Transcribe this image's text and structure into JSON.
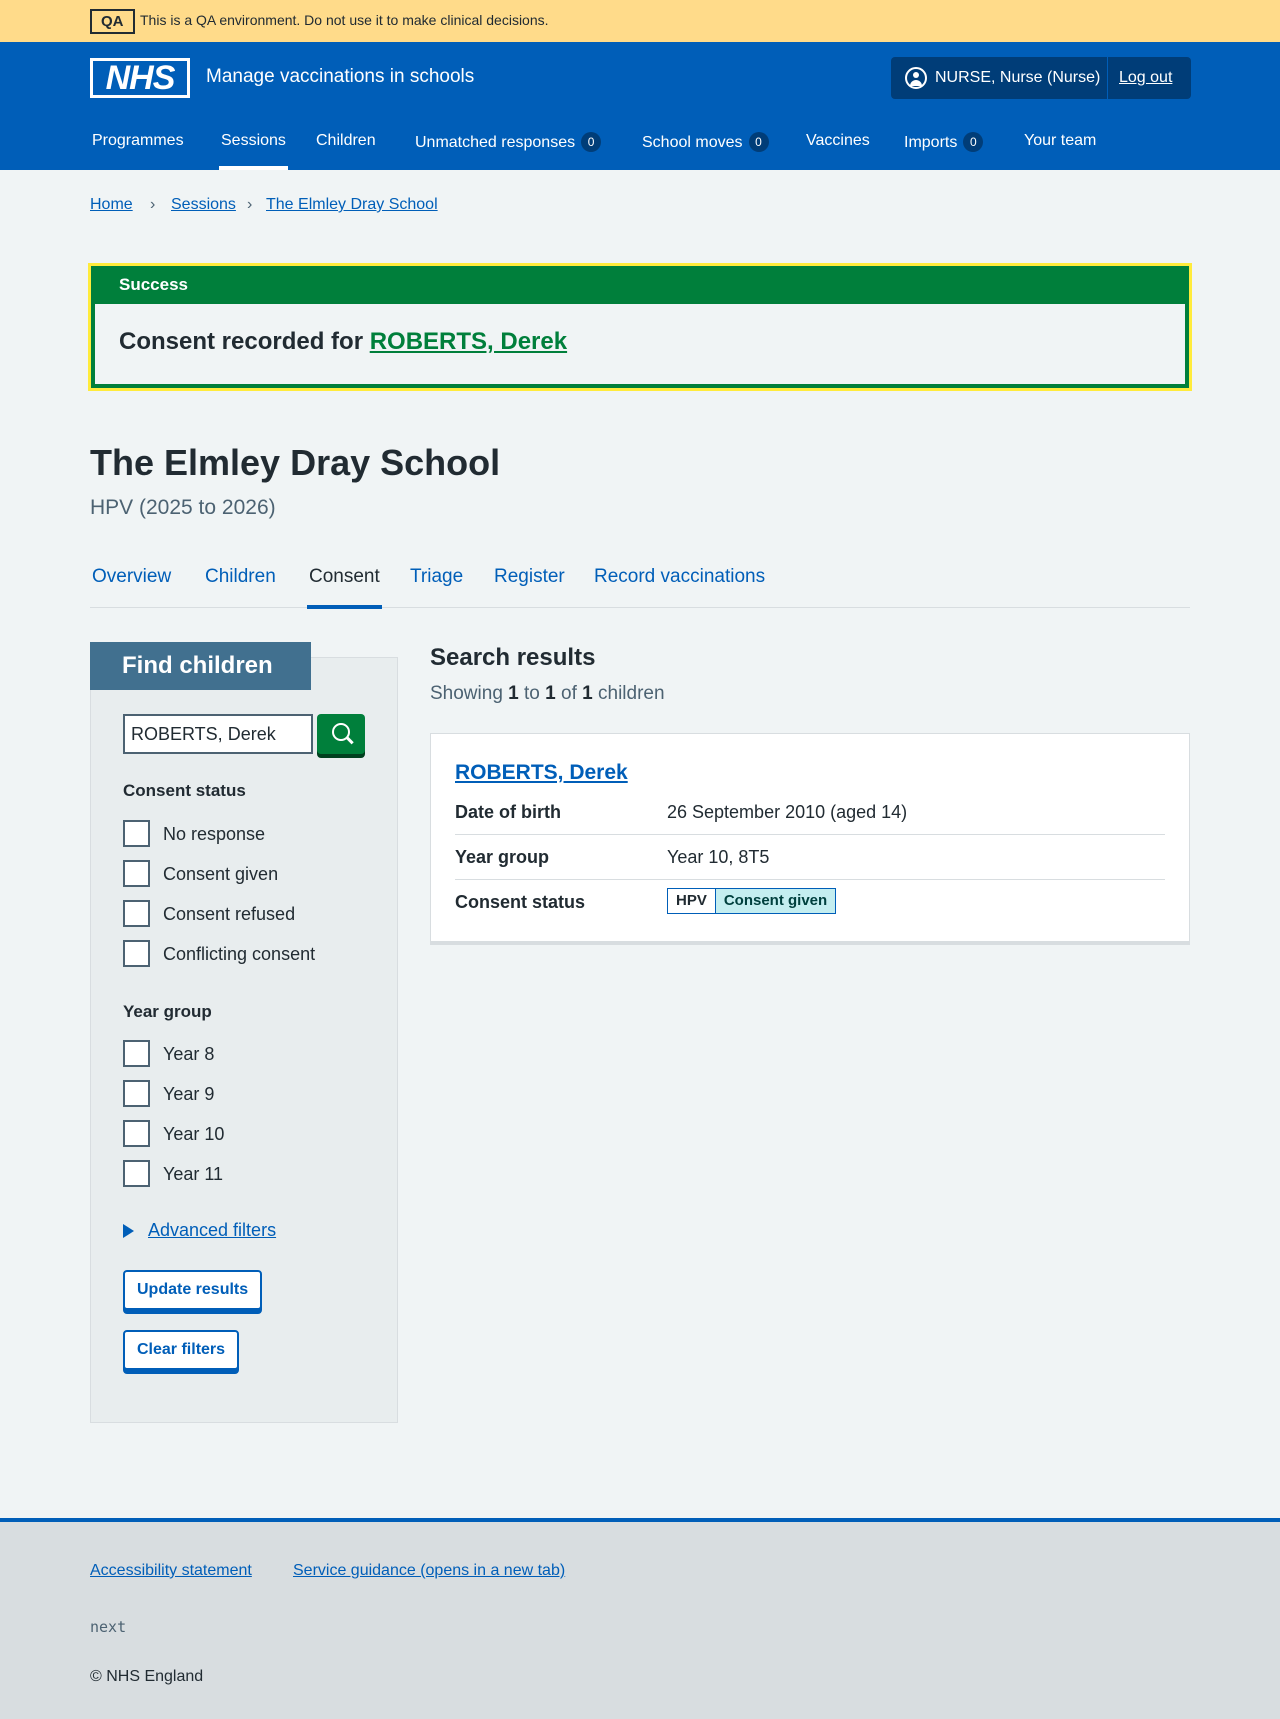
{
  "qa_banner": {
    "tag": "QA",
    "message": "This is a QA environment. Do not use it to make clinical decisions."
  },
  "header": {
    "logo_text": "NHS",
    "service_name": "Manage vaccinations in schools",
    "account_name": "NURSE, Nurse (Nurse)",
    "logout_label": "Log out",
    "nav": [
      {
        "label": "Programmes"
      },
      {
        "label": "Sessions",
        "active": true
      },
      {
        "label": "Children"
      },
      {
        "label": "Unmatched responses",
        "count": "0"
      },
      {
        "label": "School moves",
        "count": "0"
      },
      {
        "label": "Vaccines"
      },
      {
        "label": "Imports",
        "count": "0"
      },
      {
        "label": "Your team"
      }
    ]
  },
  "breadcrumb": [
    "Home",
    "Sessions",
    "The Elmley Dray School"
  ],
  "success_banner": {
    "heading": "Success",
    "message_prefix": "Consent recorded for ",
    "message_link": "ROBERTS, Derek"
  },
  "page": {
    "title": "The Elmley Dray School",
    "caption": "HPV (2025 to 2026)"
  },
  "subtabs": [
    {
      "label": "Overview"
    },
    {
      "label": "Children"
    },
    {
      "label": "Consent",
      "active": true
    },
    {
      "label": "Triage"
    },
    {
      "label": "Register"
    },
    {
      "label": "Record vaccinations"
    }
  ],
  "filters": {
    "title": "Find children",
    "search_value": "ROBERTS, Derek",
    "consent_status": {
      "title": "Consent status",
      "options": [
        "No response",
        "Consent given",
        "Consent refused",
        "Conflicting consent"
      ]
    },
    "year_group": {
      "title": "Year group",
      "options": [
        "Year 8",
        "Year 9",
        "Year 10",
        "Year 11"
      ]
    },
    "advanced_label": "Advanced filters",
    "update_label": "Update results",
    "clear_label": "Clear filters"
  },
  "results": {
    "title": "Search results",
    "count_parts": [
      "Showing ",
      "1",
      " to ",
      "1",
      " of ",
      "1",
      " children"
    ],
    "child": {
      "name": "ROBERTS, Derek",
      "dob_label": "Date of birth",
      "dob_value": "26 September 2010 (aged 14)",
      "year_label": "Year group",
      "year_value": "Year 10, 8T5",
      "consent_label": "Consent status",
      "consent_programme": "HPV",
      "consent_state": "Consent given"
    }
  },
  "footer": {
    "links": [
      "Accessibility statement",
      "Service guidance (opens in a new tab)"
    ],
    "environment": "next",
    "copyright": "© NHS England"
  }
}
